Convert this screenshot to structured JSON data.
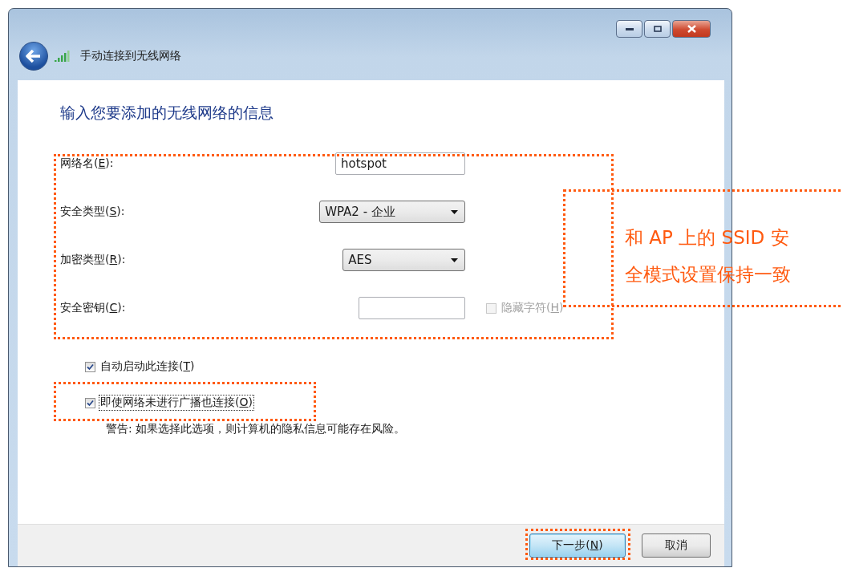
{
  "window": {
    "title": "手动连接到无线网络"
  },
  "heading": "输入您要添加的无线网络的信息",
  "fields": [
    {
      "kind": "text",
      "label": "网络名(E):",
      "value": "hotspot"
    },
    {
      "kind": "dropdown",
      "label": "安全类型(S):",
      "value": "WPA2 - 企业"
    },
    {
      "kind": "dropdown",
      "label": "加密类型(R):",
      "value": "AES"
    },
    {
      "kind": "password",
      "label": "安全密钥(C):"
    }
  ],
  "hide_characters": {
    "label": "隐藏字符(H)",
    "checked": false,
    "disabled": true
  },
  "options": [
    {
      "label": "自动启动此连接(T)",
      "checked": true,
      "focused": false
    },
    {
      "label": "即使网络未进行广播也连接(O)",
      "checked": true,
      "focused": true
    }
  ],
  "warning": "警告: 如果选择此选项，则计算机的隐私信息可能存在风险。",
  "buttons": [
    {
      "label": "下一步(N)",
      "default": true
    },
    {
      "label": "取消",
      "default": false
    }
  ],
  "annotation": {
    "lines": [
      "和 AP 上的 SSID 安",
      "全模式设置保持一致"
    ]
  }
}
